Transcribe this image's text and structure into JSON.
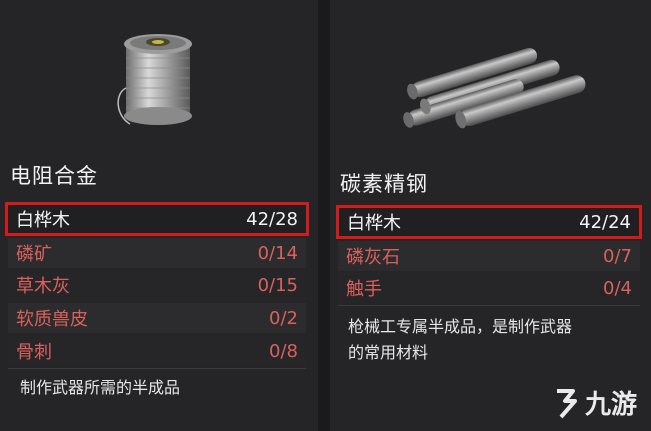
{
  "left_card": {
    "title": "电阻合金",
    "icon": "wire-spool-icon",
    "materials": [
      {
        "name": "白桦木",
        "qty": "42/28",
        "highlighted": true
      },
      {
        "name": "磷矿",
        "qty": "0/14"
      },
      {
        "name": "草木灰",
        "qty": "0/15"
      },
      {
        "name": "软质兽皮",
        "qty": "0/2"
      },
      {
        "name": "骨刺",
        "qty": "0/8"
      }
    ],
    "description": "制作武器所需的半成品"
  },
  "right_card": {
    "title": "碳素精钢",
    "icon": "steel-rods-icon",
    "materials": [
      {
        "name": "白桦木",
        "qty": "42/24",
        "highlighted": true
      },
      {
        "name": "磷灰石",
        "qty": "0/7"
      },
      {
        "name": "触手",
        "qty": "0/4"
      }
    ],
    "description_line1": "枪械工专属半成品，是制作武器",
    "description_line2": "的常用材料"
  },
  "watermark": {
    "text": "九游",
    "icon": "jiuyou-logo-icon"
  },
  "colors": {
    "missing": "#d9615c",
    "highlight_border": "#d01c1c",
    "text": "#f2f2f2"
  }
}
